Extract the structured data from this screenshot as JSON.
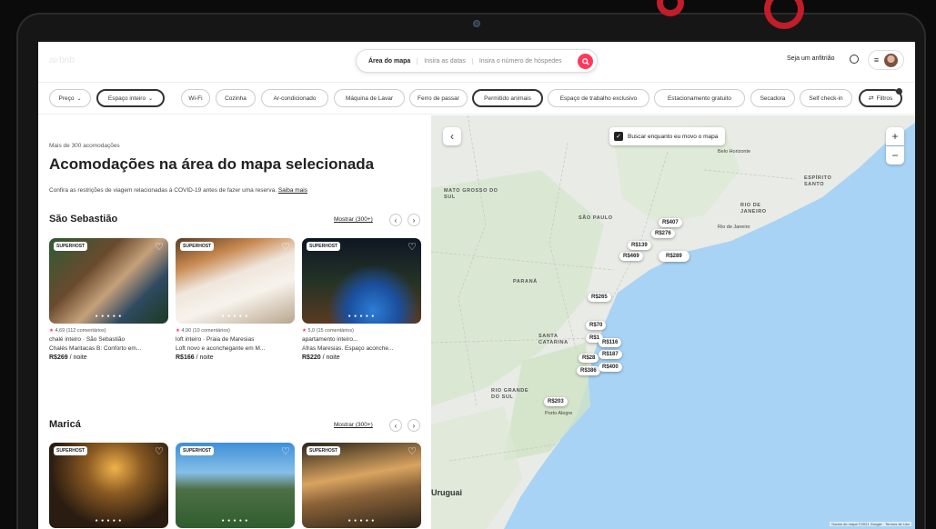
{
  "header": {
    "logo": "airbnb",
    "search": {
      "location": "Área do mapa",
      "dates": "Insira as datas",
      "guests": "Insira o número de hóspedes"
    },
    "host_link": "Seja um anfitrião"
  },
  "filters": [
    "Preço",
    "Espaço inteiro",
    "Wi-Fi",
    "Cozinha",
    "Ar-condicionado",
    "Máquina de Lavar",
    "Ferro de passar",
    "Permitido animais",
    "Espaço de trabalho exclusivo",
    "Estacionamento gratuito",
    "Secadora",
    "Self check-in",
    "Filtros"
  ],
  "list": {
    "count": "Mais de 300 acomodações",
    "title": "Acomodações na área do mapa selecionada",
    "covid_text": "Confira as restrições de viagem relacionadas à COVID-19 antes de fazer uma reserva.",
    "covid_link": "Saiba mais",
    "sections": [
      {
        "title": "São Sebastião",
        "show_all": "Mostrar (300+)",
        "cards": [
          {
            "badge": "SUPERHOST",
            "rating": "4,69",
            "reviews": "(112 comentários)",
            "line1": "chalé inteiro · São Sebastião",
            "line2": "Chalés Maritacas B: Conforto em...",
            "price": "R$269",
            "unit": "/ noite"
          },
          {
            "badge": "SUPERHOST",
            "rating": "4,90",
            "reviews": "(10 comentários)",
            "line1": "loft inteiro · Praia de Maresias",
            "line2": "Loft novo e aconchegante em M...",
            "price": "R$166",
            "unit": "/ noite"
          },
          {
            "badge": "SUPERHOST",
            "rating": "5,0",
            "reviews": "(15 comentários)",
            "line1": "apartamento inteiro...",
            "line2": "Afras Maresias. Espaço aconche...",
            "price": "R$220",
            "unit": "/ noite"
          }
        ]
      },
      {
        "title": "Maricá",
        "show_all": "Mostrar (300+)",
        "cards": [
          {
            "badge": "SUPERHOST"
          },
          {
            "badge": "SUPERHOST"
          },
          {
            "badge": "SUPERHOST"
          }
        ]
      }
    ]
  },
  "map": {
    "toggle_label": "Buscar enquanto eu movo o mapa",
    "zoom_in": "+",
    "zoom_out": "−",
    "back": "‹",
    "pins": [
      "R$407",
      "R$276",
      "R$139",
      "R$469",
      "R$289",
      "R$265",
      "R$70",
      "R$1",
      "R$116",
      "R$187",
      "R$28",
      "R$386",
      "R$400",
      "R$203"
    ],
    "labels": {
      "mato_grosso": "MATO GROSSO DO SUL",
      "sao_paulo": "SÃO PAULO",
      "parana": "PARANÁ",
      "santa_catarina": "SANTA CATARINA",
      "rio_grande": "RIO GRANDE DO SUL",
      "rio_janeiro": "RIO DE JANEIRO",
      "espirito_santo": "ESPÍRITO SANTO",
      "rio_city": "Rio de Janeiro",
      "belo_horizonte": "Belo Horizonte",
      "porto_alegre": "Porto Alegre",
      "uruguai": "Uruguai"
    },
    "attribution": "Dados do mapa ©2021 Google · Termos de Uso"
  }
}
